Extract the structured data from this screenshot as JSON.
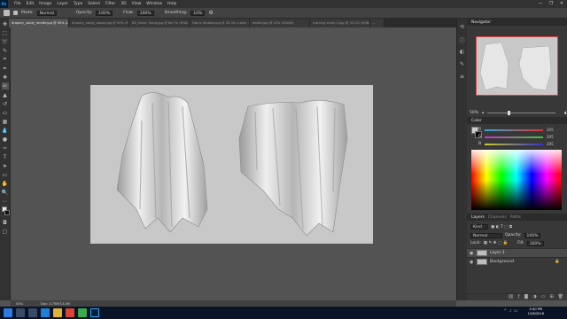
{
  "app": {
    "logo": "Ps"
  },
  "menu": [
    "File",
    "Edit",
    "Image",
    "Layer",
    "Type",
    "Select",
    "Filter",
    "3D",
    "View",
    "Window",
    "Help"
  ],
  "window_controls": [
    "—",
    "❐",
    "✕"
  ],
  "options": {
    "mode_label": "Mode:",
    "mode": "Normal",
    "opacity_label": "Opacity:",
    "opacity": "100%",
    "flow_label": "Flow:",
    "flow": "100%",
    "smoothing_label": "Smoothing:",
    "smoothing": "10%"
  },
  "tabs": [
    "drapery_study_render.jpg @ 50% (Layer 1, RGB/8#) *",
    "drapery_study_obose.jpg @ 50% (RGB/8)",
    "B5_Fabric Study.jpg @ 66.7% (RGB/8)",
    "Fabric Studies.jpg @ 33.3% (Layer 1, RG...",
    "folds2.jpg @ 25% (RGB/8)",
    "clothing study 2.jpg @ 33.3% (RGB/8)",
    "..."
  ],
  "active_tab_index": 0,
  "panels": {
    "navigator_title": "Navigator",
    "zoom": "50%",
    "color_title": "Color",
    "channels": [
      {
        "label": "R",
        "value": "205",
        "color": "#c33"
      },
      {
        "label": "G",
        "value": "205",
        "color": "#3a3"
      },
      {
        "label": "B",
        "value": "205",
        "color": "#33c"
      }
    ],
    "layers_tabs": [
      "Layers",
      "Channels",
      "Paths"
    ],
    "kind_label": "Kind",
    "blend": "Normal",
    "opacity_label": "Opacity:",
    "opacity": "100%",
    "lock_label": "Lock:",
    "fill_label": "Fill:",
    "fill": "100%",
    "layers": [
      {
        "name": "Layer 1",
        "selected": true
      },
      {
        "name": "Background",
        "selected": false
      }
    ]
  },
  "status": {
    "zoom": "50%",
    "doc": "Doc: 3.75M/13.4M"
  },
  "clock": {
    "time": "5:40 PM",
    "date": "12/6/2018"
  },
  "tray": [
    "^",
    "♪",
    "☐"
  ],
  "colors": {
    "menubar": "#323232",
    "canvas": "#c8c8c8",
    "workspace": "#535353",
    "taskbar": "#0b1426"
  }
}
